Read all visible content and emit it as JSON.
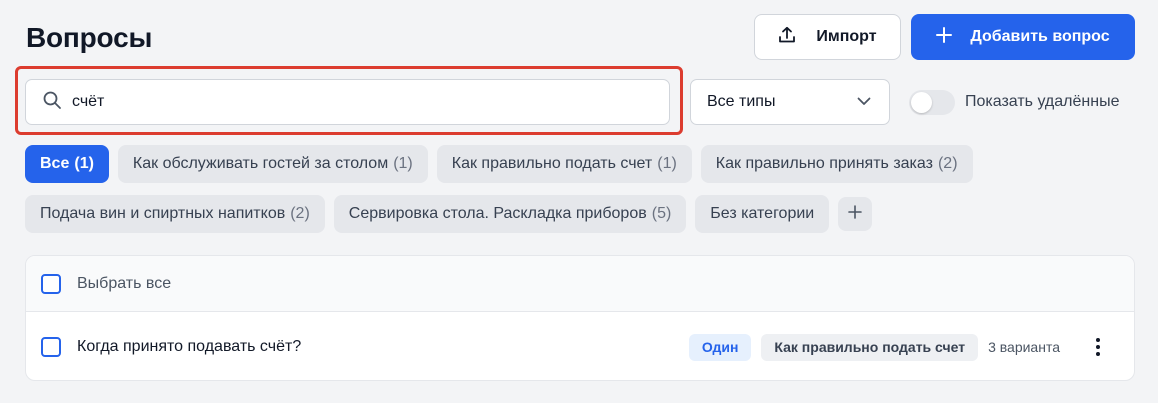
{
  "header": {
    "title": "Вопросы",
    "import_label": "Импорт",
    "add_label": "Добавить вопрос"
  },
  "filters": {
    "search_value": "счёт",
    "type_select": "Все типы",
    "show_deleted_label": "Показать удалённые",
    "show_deleted_on": false
  },
  "categories": [
    {
      "label": "Все",
      "count": "(1)",
      "active": true
    },
    {
      "label": "Как обслуживать гостей за столом",
      "count": "(1)"
    },
    {
      "label": "Как правильно подать счет",
      "count": "(1)"
    },
    {
      "label": "Как правильно принять заказ",
      "count": "(2)"
    },
    {
      "label": "Подача вин и спиртных напитков",
      "count": "(2)"
    },
    {
      "label": "Сервировка стола. Раскладка приборов",
      "count": "(5)"
    },
    {
      "label": "Без категории",
      "count": ""
    }
  ],
  "list": {
    "select_all_label": "Выбрать все",
    "rows": [
      {
        "question": "Когда принято подавать счёт?",
        "type": "Один",
        "category": "Как правильно подать счет",
        "variants": "3 варианта"
      }
    ]
  },
  "colors": {
    "accent": "#2563eb",
    "highlight": "#dc3c2f",
    "background": "#f3f4f6"
  },
  "icons": [
    "upload-icon",
    "plus-icon",
    "search-icon",
    "chevron-down-icon",
    "kebab-menu-icon"
  ]
}
